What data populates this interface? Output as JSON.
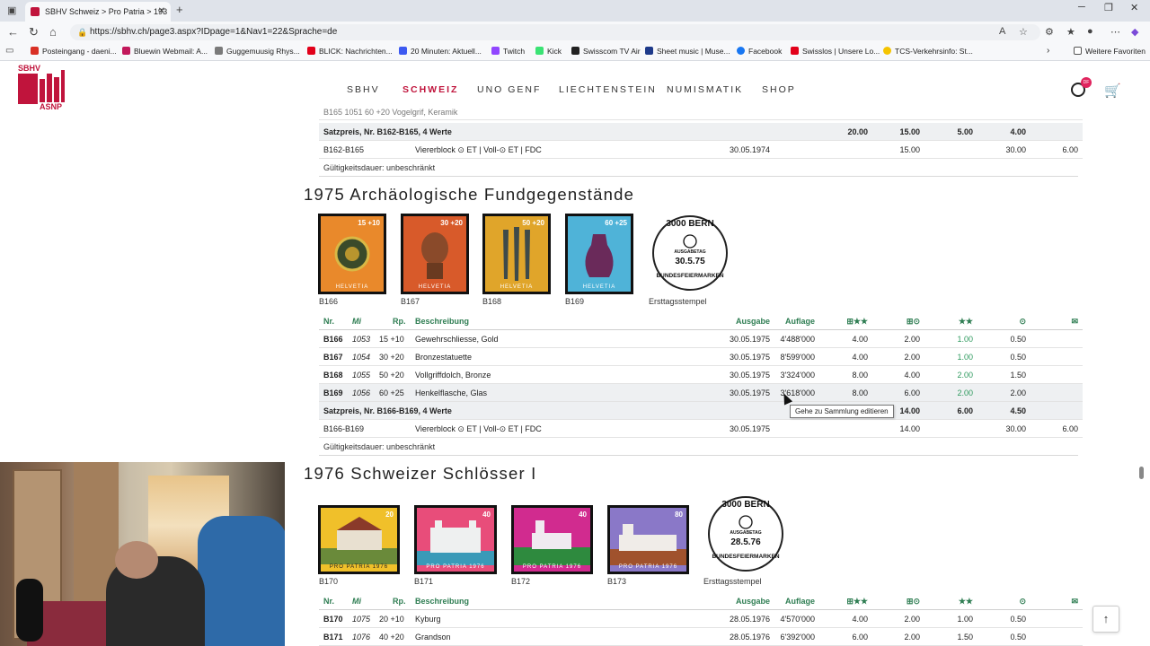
{
  "browser": {
    "tab_title": "SBHV Schweiz > Pro Patria > 193",
    "url": "https://sbhv.ch/page3.aspx?IDpage=1&Nav1=22&Sprache=de",
    "bookmarks": [
      "Posteingang - daeni...",
      "Bluewin Webmail: A...",
      "Guggemuusig Rhys...",
      "BLICK: Nachrichten...",
      "20 Minuten: Aktuell...",
      "Twitch",
      "Kick",
      "Swisscom TV Air",
      "Sheet music | Muse...",
      "Facebook",
      "Swisslos | Unsere Lo...",
      "TCS-Verkehrsinfo: St..."
    ],
    "more_favorites": "Weitere Favoriten"
  },
  "site": {
    "logo_top": "SBHV",
    "logo_bottom": "ASNP",
    "nav": [
      "SBHV",
      "SCHWEIZ",
      "UNO GENF",
      "LIECHTENSTEIN",
      "NUMISMATIK",
      "SHOP"
    ],
    "user_badge": "DF"
  },
  "top_block": {
    "partial_row": "B165   1051   60 +20   Vogelgrif, Keramik",
    "sum_label": "Satzpreis, Nr. B162-B165, 4 Werte",
    "sum_vals": [
      "20.00",
      "15.00",
      "5.00",
      "4.00"
    ],
    "block_nr": "B162-B165",
    "block_desc": "Viererblock ⊙ ET | Voll-⊙ ET | FDC",
    "block_date": "30.05.1974",
    "block_vals": [
      "15.00",
      "30.00",
      "6.00"
    ],
    "validity": "Gültigkeitsdauer: unbeschränkt"
  },
  "section1975": {
    "title": "1975 Archäologische Fundgegenstände",
    "stamps": [
      {
        "cap": "B166",
        "val": "15 +10",
        "label": "HELVETIA",
        "color": "#e9892b"
      },
      {
        "cap": "B167",
        "val": "30 +20",
        "label": "HELVETIA",
        "color": "#d85a2a"
      },
      {
        "cap": "B168",
        "val": "50 +20",
        "label": "HELVETIA",
        "color": "#e0a52a"
      },
      {
        "cap": "B169",
        "val": "60 +25",
        "label": "HELVETIA",
        "color": "#4fb3d8"
      }
    ],
    "postmark_top": "3000 BERN",
    "postmark_mid": "AUSGABETAG",
    "postmark_date": "30.5.75",
    "postmark_bottom": "BUNDESFEIERMARKEN",
    "postmark_cap": "Ersttagsstempel",
    "headers": [
      "Nr.",
      "Mi",
      "Rp.",
      "Beschreibung",
      "Ausgabe",
      "Auflage",
      "⊞★★",
      "⊞⊙",
      "★★",
      "⊙",
      "✉"
    ],
    "rows": [
      {
        "nr": "B166",
        "mi": "1053",
        "rp": "15 +10",
        "desc": "Gewehrschliesse, Gold",
        "date": "30.05.1975",
        "qty": "4'488'000",
        "v1": "4.00",
        "v2": "2.00",
        "v3": "1.00",
        "v4": "0.50"
      },
      {
        "nr": "B167",
        "mi": "1054",
        "rp": "30 +20",
        "desc": "Bronzestatuette",
        "date": "30.05.1975",
        "qty": "8'599'000",
        "v1": "4.00",
        "v2": "2.00",
        "v3": "1.00",
        "v4": "0.50"
      },
      {
        "nr": "B168",
        "mi": "1055",
        "rp": "50 +20",
        "desc": "Vollgriffdolch, Bronze",
        "date": "30.05.1975",
        "qty": "3'324'000",
        "v1": "8.00",
        "v2": "4.00",
        "v3": "2.00",
        "v4": "1.50"
      },
      {
        "nr": "B169",
        "mi": "1056",
        "rp": "60 +25",
        "desc": "Henkelflasche, Glas",
        "date": "30.05.1975",
        "qty": "3'618'000",
        "v1": "8.00",
        "v2": "6.00",
        "v3": "2.00",
        "v4": "2.00"
      }
    ],
    "sum_label": "Satzpreis, Nr. B166-B169, 4 Werte",
    "sum_vals": [
      "14.00",
      "6.00",
      "4.50"
    ],
    "block_nr": "B166-B169",
    "block_desc": "Viererblock ⊙ ET | Voll-⊙ ET | FDC",
    "block_date": "30.05.1975",
    "block_vals": [
      "14.00",
      "30.00",
      "6.00"
    ],
    "validity": "Gültigkeitsdauer: unbeschränkt",
    "tooltip": "Gehe zu Sammlung editieren"
  },
  "section1976": {
    "title": "1976 Schweizer Schlösser I",
    "stamps": [
      {
        "cap": "B170",
        "val": "20",
        "label": "PRO PATRIA 1976",
        "color": "#f0c02a"
      },
      {
        "cap": "B171",
        "val": "40",
        "label": "PRO PATRIA 1976",
        "color": "#e84d7a"
      },
      {
        "cap": "B172",
        "val": "40",
        "label": "PRO PATRIA 1976",
        "color": "#d12b8f"
      },
      {
        "cap": "B173",
        "val": "80",
        "label": "PRO PATRIA 1976",
        "color": "#8a78c8"
      }
    ],
    "postmark_top": "3000 BERN",
    "postmark_mid": "AUSGABETAG",
    "postmark_date": "28.5.76",
    "postmark_bottom": "BUNDESFEIERMARKEN",
    "postmark_cap": "Ersttagsstempel",
    "headers": [
      "Nr.",
      "Mi",
      "Rp.",
      "Beschreibung",
      "Ausgabe",
      "Auflage",
      "⊞★★",
      "⊞⊙",
      "★★",
      "⊙",
      "✉"
    ],
    "rows": [
      {
        "nr": "B170",
        "mi": "1075",
        "rp": "20 +10",
        "desc": "Kyburg",
        "date": "28.05.1976",
        "qty": "4'570'000",
        "v1": "4.00",
        "v2": "2.00",
        "v3": "1.00",
        "v4": "0.50"
      },
      {
        "nr": "B171",
        "mi": "1076",
        "rp": "40 +20",
        "desc": "Grandson",
        "date": "28.05.1976",
        "qty": "6'392'000",
        "v1": "6.00",
        "v2": "2.00",
        "v3": "1.50",
        "v4": "0.50"
      }
    ]
  }
}
